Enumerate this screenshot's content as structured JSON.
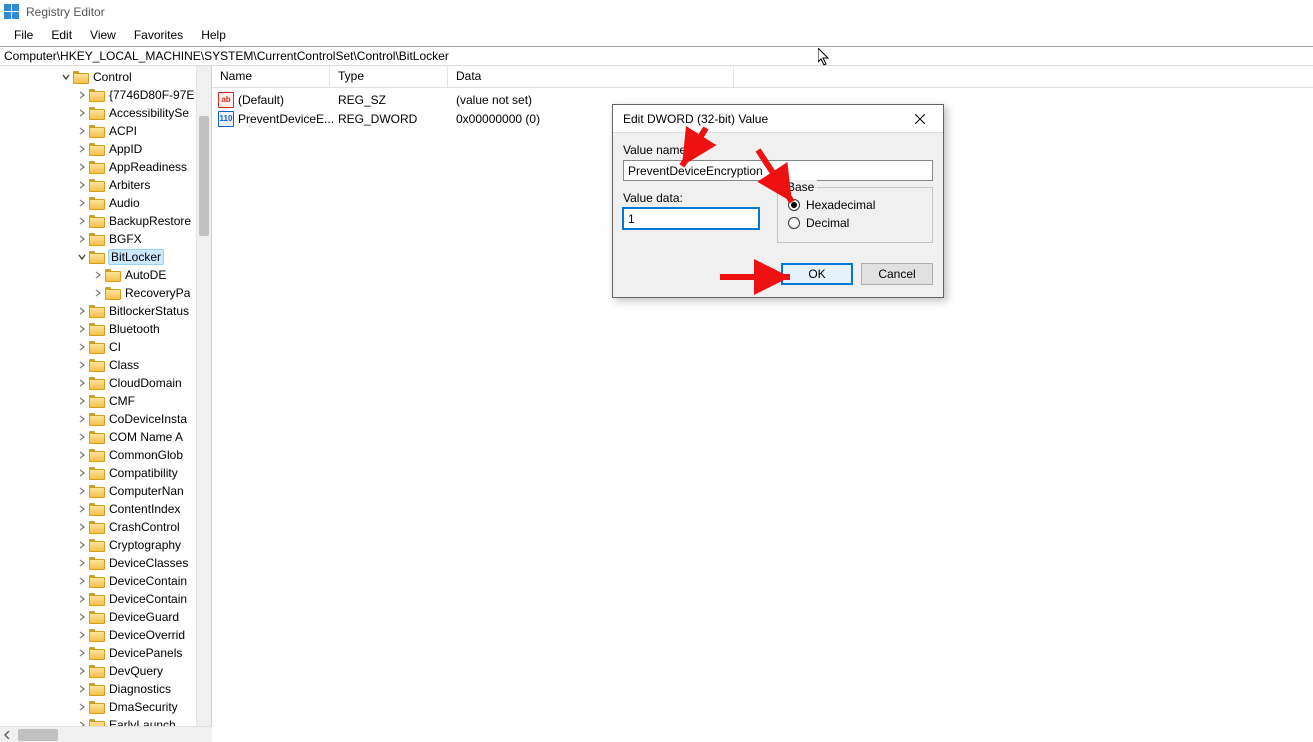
{
  "app": {
    "title": "Registry Editor"
  },
  "menu": [
    "File",
    "Edit",
    "View",
    "Favorites",
    "Help"
  ],
  "address": "Computer\\HKEY_LOCAL_MACHINE\\SYSTEM\\CurrentControlSet\\Control\\BitLocker",
  "tree": {
    "root": "Control",
    "selected": "BitLocker",
    "bitlocker_children": [
      "AutoDE",
      "RecoveryPa"
    ],
    "items": [
      "{7746D80F-97E",
      "AccessibilitySe",
      "ACPI",
      "AppID",
      "AppReadiness",
      "Arbiters",
      "Audio",
      "BackupRestore",
      "BGFX",
      "BitLocker",
      "BitlockerStatus",
      "Bluetooth",
      "CI",
      "Class",
      "CloudDomain",
      "CMF",
      "CoDeviceInsta",
      "COM Name A",
      "CommonGlob",
      "Compatibility",
      "ComputerNan",
      "ContentIndex",
      "CrashControl",
      "Cryptography",
      "DeviceClasses",
      "DeviceContain",
      "DeviceContain",
      "DeviceGuard",
      "DeviceOverrid",
      "DevicePanels",
      "DevQuery",
      "Diagnostics",
      "DmaSecurity",
      "EarlyLaunch"
    ]
  },
  "list": {
    "columns": {
      "name": "Name",
      "type": "Type",
      "data": "Data"
    },
    "rows": [
      {
        "icon": "sz",
        "name": "(Default)",
        "type": "REG_SZ",
        "data": "(value not set)"
      },
      {
        "icon": "dw",
        "name": "PreventDeviceE...",
        "type": "REG_DWORD",
        "data": "0x00000000 (0)"
      }
    ]
  },
  "dialog": {
    "title": "Edit DWORD (32-bit) Value",
    "value_name_label": "Value name:",
    "value_name": "PreventDeviceEncryption",
    "value_data_label": "Value data:",
    "value_data": "1",
    "base_label": "Base",
    "radio_hex": "Hexadecimal",
    "radio_dec": "Decimal",
    "base_selected": "hex",
    "ok": "OK",
    "cancel": "Cancel"
  }
}
